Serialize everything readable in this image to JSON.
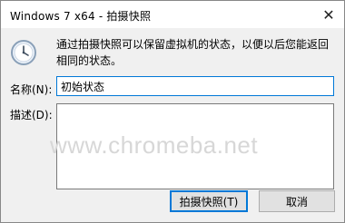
{
  "window": {
    "title": "Windows 7 x64 - 拍摄快照",
    "close_glyph": "✕"
  },
  "dialog": {
    "description": "通过拍摄快照可以保留虚拟机的状态，以便以后您能返回相同的状态。",
    "name_label": "名称(N):",
    "name_value": "初始状态",
    "desc_label": "描述(D):",
    "desc_value": "",
    "watermark": "www.chromeba.net"
  },
  "buttons": {
    "snapshot": "拍摄快照(T)",
    "cancel": "取消"
  },
  "colors": {
    "accent": "#0078d7",
    "background": "#f0f0f0"
  }
}
